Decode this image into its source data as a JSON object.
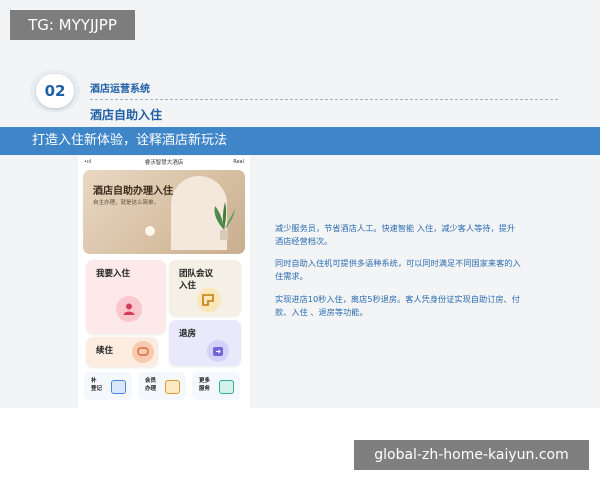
{
  "watermark_top": "TG: MYYJJPP",
  "watermark_bottom": "global-zh-home-kaiyun.com",
  "slide": {
    "number": "02",
    "section": "酒店运营系统",
    "topic": "酒店自助入住",
    "banner": "打造入住新体验，诠释酒店新玩法"
  },
  "phone": {
    "signal": "•ııl",
    "hotel_name": "睿沃智慧大酒店",
    "status_right": "Real",
    "hero_title": "酒店自助办理入住",
    "hero_subtitle": "自主办理，就是这么简单。",
    "tiles": {
      "checkin": "我要入住",
      "group": "团队会议\n入住",
      "stay": "续住",
      "checkout": "退房"
    },
    "mini": {
      "invoice": "补\n登记",
      "member": "会员\n办理",
      "more": "更多\n服务"
    }
  },
  "description": [
    "减少服务员，节省酒店人工。快速智能 入住，减少客人等待，提升酒店经营档次。",
    "同时自助入住机可提供多语种系统，可以同时满足不同国家来客的入住需求。",
    "实现进店10秒入住，离店5秒退房。客人凭身份证实现自助订房、付款、入住 、退房等功能。"
  ],
  "colors": {
    "brand_blue": "#1f5fa6",
    "banner_blue": "#3f86c8",
    "text_blue": "#2b6cb0"
  }
}
